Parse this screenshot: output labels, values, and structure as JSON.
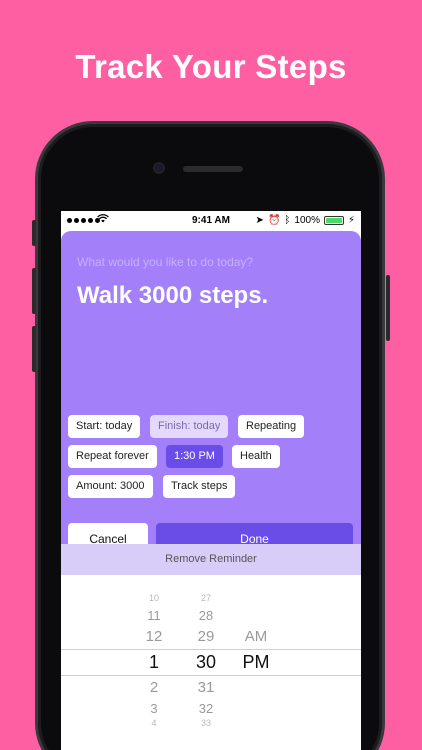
{
  "headline": "Track Your Steps",
  "status_bar": {
    "time": "9:41 AM",
    "battery": "100%",
    "battery_level": 1.0
  },
  "card": {
    "question": "What would you like to do today?",
    "task": "Walk 3000 steps."
  },
  "chips": {
    "start": "Start: today",
    "finish": "Finish: today",
    "repeating": "Repeating",
    "repeat_forever": "Repeat forever",
    "time": "1:30 PM",
    "health": "Health",
    "amount": "Amount: 3000",
    "track_steps": "Track steps"
  },
  "buttons": {
    "cancel": "Cancel",
    "done": "Done"
  },
  "remove_reminder": "Remove Reminder",
  "picker": {
    "hours": [
      "10",
      "11",
      "12",
      "1",
      "2",
      "3",
      "4"
    ],
    "minutes": [
      "27",
      "28",
      "29",
      "30",
      "31",
      "32",
      "33"
    ],
    "ampm": [
      "AM",
      "PM"
    ]
  },
  "colors": {
    "background": "#fe5fa3",
    "card": "#a380fa",
    "accent": "#6a4de6",
    "remove_bar": "#d8cdf9"
  }
}
